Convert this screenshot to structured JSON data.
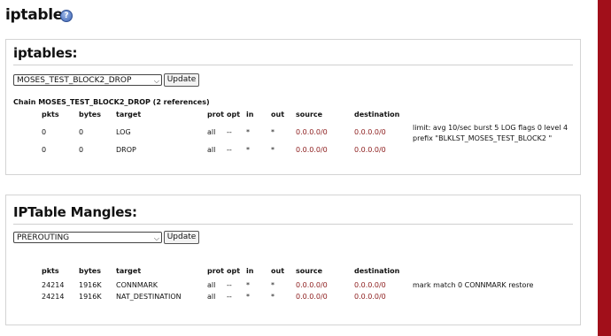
{
  "page": {
    "title": "iptables",
    "help_icon": "help-icon"
  },
  "panel1": {
    "heading": "iptables:",
    "select_value": "MOSES_TEST_BLOCK2_DROP",
    "update_label": "Update",
    "chain_title": "Chain MOSES_TEST_BLOCK2_DROP (2 references)",
    "columns": [
      "pkts",
      "bytes",
      "target",
      "prot",
      "opt",
      "in",
      "out",
      "source",
      "destination"
    ],
    "rows": [
      {
        "pkts": "0",
        "bytes": "0",
        "target": "LOG",
        "prot": "all",
        "opt": "--",
        "in": "*",
        "out": "*",
        "source": "0.0.0.0/0",
        "destination": "0.0.0.0/0",
        "extra_line1": "limit: avg 10/sec burst 5 LOG flags 0 level 4",
        "extra_line2": "prefix \"BLKLST_MOSES_TEST_BLOCK2 \""
      },
      {
        "pkts": "0",
        "bytes": "0",
        "target": "DROP",
        "prot": "all",
        "opt": "--",
        "in": "*",
        "out": "*",
        "source": "0.0.0.0/0",
        "destination": "0.0.0.0/0",
        "extra_line1": "",
        "extra_line2": ""
      }
    ]
  },
  "panel2": {
    "heading": "IPTable Mangles:",
    "select_value": "PREROUTING",
    "update_label": "Update",
    "columns": [
      "pkts",
      "bytes",
      "target",
      "prot",
      "opt",
      "in",
      "out",
      "source",
      "destination"
    ],
    "rows": [
      {
        "pkts": "24214",
        "bytes": "1916K",
        "target": "CONNMARK",
        "prot": "all",
        "opt": "--",
        "in": "*",
        "out": "*",
        "source": "0.0.0.0/0",
        "destination": "0.0.0.0/0",
        "extra": "mark match 0 CONNMARK restore"
      },
      {
        "pkts": "24214",
        "bytes": "1916K",
        "target": "NAT_DESTINATION",
        "prot": "all",
        "opt": "--",
        "in": "*",
        "out": "*",
        "source": "0.0.0.0/0",
        "destination": "0.0.0.0/0",
        "extra": ""
      }
    ]
  },
  "colors": {
    "scrollbar": "#a10f1a",
    "address": "#8b1a1a"
  }
}
